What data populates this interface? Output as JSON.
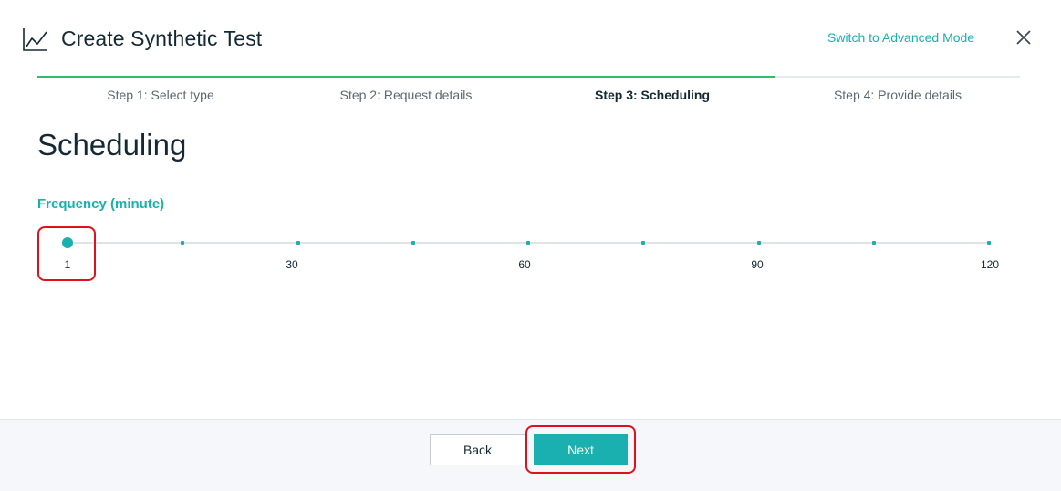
{
  "header": {
    "title": "Create Synthetic Test",
    "advanced_link": "Switch to Advanced Mode",
    "title_icon": "line-chart-icon",
    "close_icon": "close-icon"
  },
  "progress": {
    "completed_fraction": 0.75,
    "steps": [
      {
        "label": "Step 1: Select type",
        "state": "complete"
      },
      {
        "label": "Step 2: Request details",
        "state": "complete"
      },
      {
        "label": "Step 3: Scheduling",
        "state": "active"
      },
      {
        "label": "Step 4: Provide details",
        "state": "pending"
      }
    ]
  },
  "main": {
    "section_title": "Scheduling",
    "frequency_label": "Frequency (minute)",
    "slider": {
      "min": 1,
      "max": 120,
      "value": 1,
      "tick_labels": [
        "1",
        "30",
        "60",
        "90",
        "120"
      ]
    }
  },
  "footer": {
    "back_label": "Back",
    "next_label": "Next"
  },
  "colors": {
    "accent": "#1ab0b0",
    "progress": "#2ebf6e",
    "highlight": "#e0111d"
  }
}
